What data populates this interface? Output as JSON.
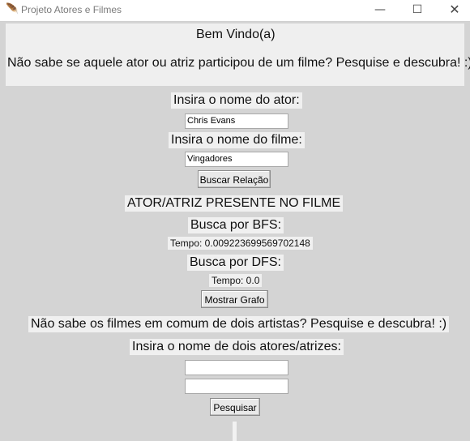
{
  "window": {
    "title": "Projeto Atores e Filmes",
    "icon": "feather-icon",
    "controls": {
      "minimize": "—",
      "maximize": "☐",
      "close": "✕"
    }
  },
  "welcome": {
    "title": "Bem Vindo(a)",
    "subtitle": "Não sabe se aquele ator ou atriz participou de um filme? Pesquise e descubra! :)"
  },
  "relation_search": {
    "actor_label": "Insira o nome do ator:",
    "actor_value": "Chris Evans",
    "movie_label": "Insira o nome do filme:",
    "movie_value": "Vingadores",
    "button_label": "Buscar Relação",
    "result": "ATOR/ATRIZ PRESENTE NO FILME",
    "bfs_label": "Busca por BFS:",
    "bfs_time": "Tempo: 0.009223699569702148",
    "dfs_label": "Busca por DFS:",
    "dfs_time": "Tempo: 0.0",
    "graph_button_label": "Mostrar Grafo"
  },
  "common_movies": {
    "prompt": "Não sabe os filmes em comum de dois artistas? Pesquise e descubra! :)",
    "label": "Insira o nome de dois atores/atrizes:",
    "actor1_value": "",
    "actor2_value": "",
    "button_label": "Pesquisar"
  }
}
